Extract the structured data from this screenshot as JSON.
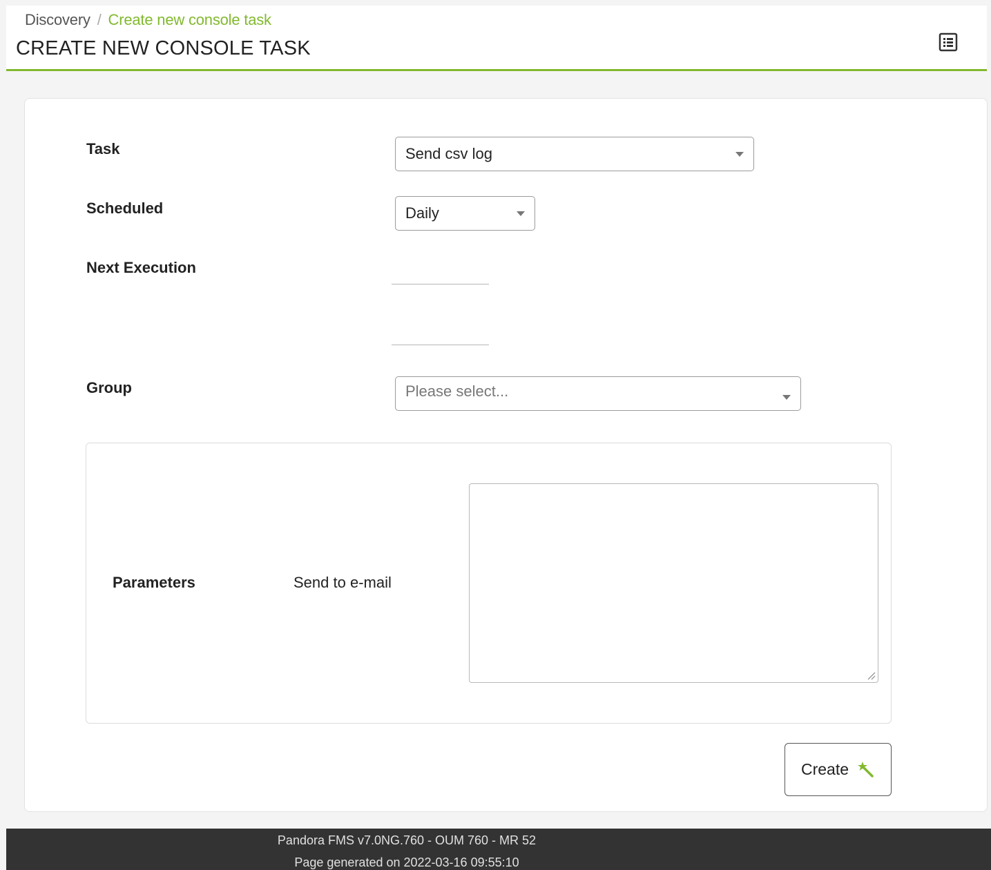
{
  "breadcrumb": {
    "parent": "Discovery",
    "separator": "/",
    "current": "Create new console task"
  },
  "page_title": "CREATE NEW CONSOLE TASK",
  "header_icons": {
    "view_toggle": "list-view-icon"
  },
  "form": {
    "task": {
      "label": "Task",
      "value": "Send csv log"
    },
    "scheduled": {
      "label": "Scheduled",
      "value": "Daily"
    },
    "next_execution": {
      "label": "Next Execution",
      "date_value": "",
      "time_value": ""
    },
    "group": {
      "label": "Group",
      "placeholder": "Please select..."
    },
    "parameters": {
      "label": "Parameters",
      "email_label": "Send to e-mail",
      "email_value": ""
    },
    "create_button": {
      "label": "Create",
      "icon": "magic-wand-icon"
    }
  },
  "footer": {
    "version": "Pandora FMS v7.0NG.760 - OUM 760 - MR 52",
    "generated": "Page generated on 2022-03-16 09:55:10"
  },
  "colors": {
    "accent": "#82b92e",
    "footer_bg": "#333333",
    "page_bg": "#f4f4f4"
  }
}
